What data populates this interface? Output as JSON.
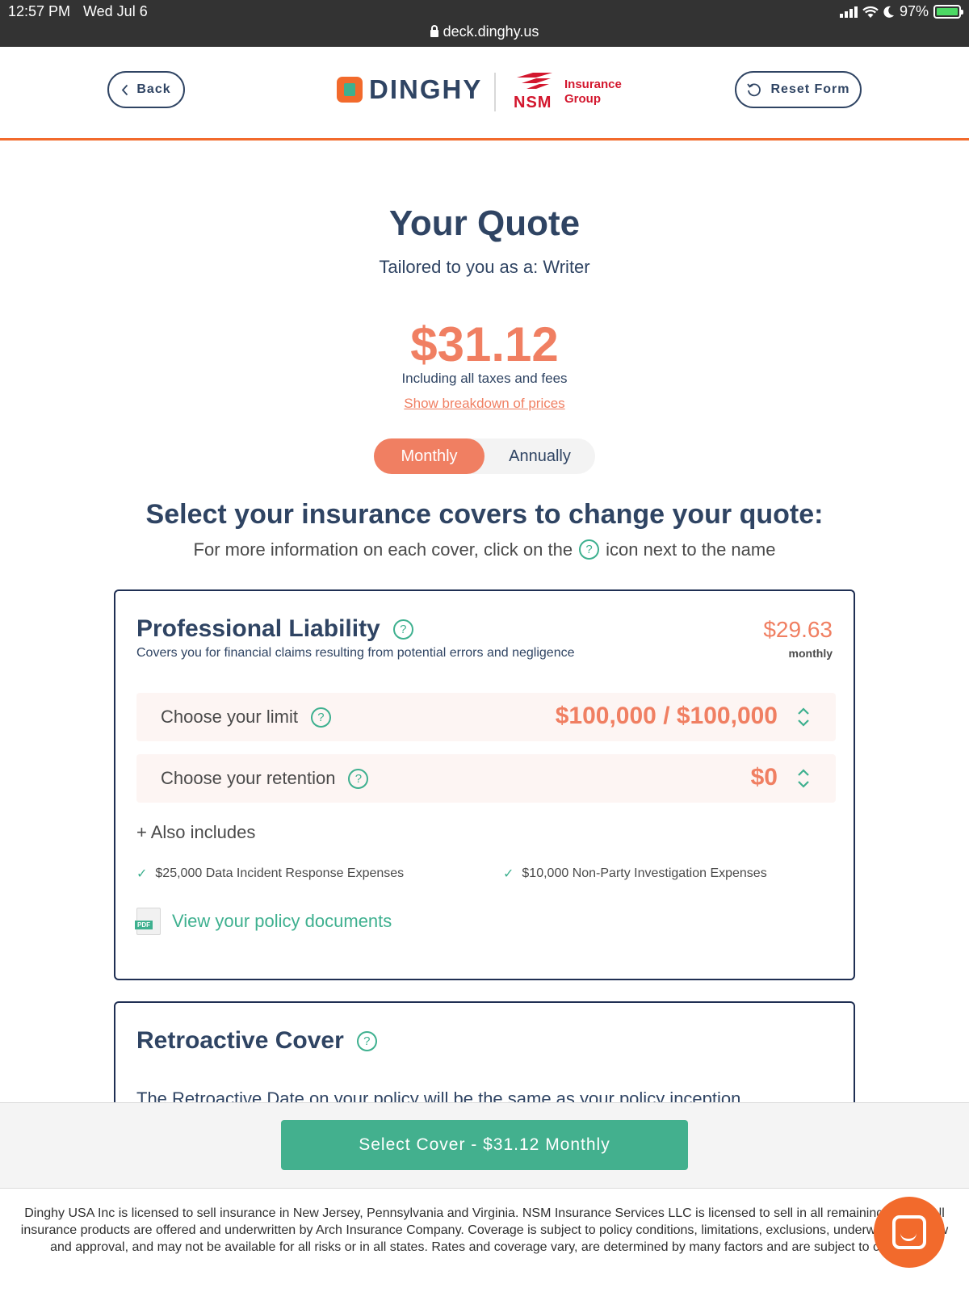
{
  "status_bar": {
    "time": "12:57 PM",
    "date": "Wed Jul 6",
    "url": "deck.dinghy.us",
    "battery": "97%"
  },
  "header": {
    "back_label": "Back",
    "reset_label": "Reset Form",
    "logo_text": "DINGHY",
    "partner_logo_nsm": "NSM",
    "partner_logo_line1": "Insurance",
    "partner_logo_line2": "Group"
  },
  "quote": {
    "title": "Your Quote",
    "subtitle": "Tailored to you as a: Writer",
    "price": "$31.12",
    "price_note": "Including all taxes and fees",
    "breakdown_link": "Show breakdown of prices",
    "toggle": {
      "monthly": "Monthly",
      "annually": "Annually",
      "selected": "monthly"
    }
  },
  "covers": {
    "heading": "Select your insurance covers to change your quote:",
    "sub_before": "For more information on each cover, click on the",
    "sub_after": "icon next to the name",
    "help_glyph": "?"
  },
  "professional_liability": {
    "title": "Professional Liability",
    "description": "Covers you for financial claims resulting from potential errors and negligence",
    "price": "$29.63",
    "price_unit": "monthly",
    "limit_label": "Choose your limit",
    "limit_value": "$100,000 / $100,000",
    "retention_label": "Choose your retention",
    "retention_value": "$0",
    "also_includes": "+ Also includes",
    "includes": [
      "$25,000 Data Incident Response Expenses",
      "$10,000 Non-Party Investigation Expenses"
    ],
    "check_glyph": "✓",
    "pdf_badge": "PDF",
    "docs_link": "View your policy documents"
  },
  "retroactive_cover": {
    "title": "Retroactive Cover",
    "text": "The Retroactive Date on your policy will be the same as your policy inception"
  },
  "bottom": {
    "select_button": "Select Cover - $31.12 Monthly"
  },
  "footer": {
    "text": "Dinghy USA Inc is licensed to sell insurance in New Jersey, Pennsylvania and Virginia. NSM Insurance Services LLC is licensed to sell in all remaining States. All insurance products are offered and underwritten by Arch Insurance Company. Coverage is subject to policy conditions, limitations, exclusions, underwriting, review and approval, and may not be available for all risks or in all states. Rates and coverage vary, are determined by many factors and are subject to change."
  },
  "colors": {
    "brand_orange": "#f26a2c",
    "price_coral": "#f07f62",
    "accent_green": "#3eb08f",
    "navy": "#2f4463"
  },
  "icons": [
    "lock-icon",
    "signal-icon",
    "wifi-icon",
    "moon-icon",
    "battery-icon",
    "chevron-left-icon",
    "refresh-icon",
    "help-icon",
    "stepper-icon",
    "check-icon",
    "pdf-icon",
    "chat-icon"
  ]
}
